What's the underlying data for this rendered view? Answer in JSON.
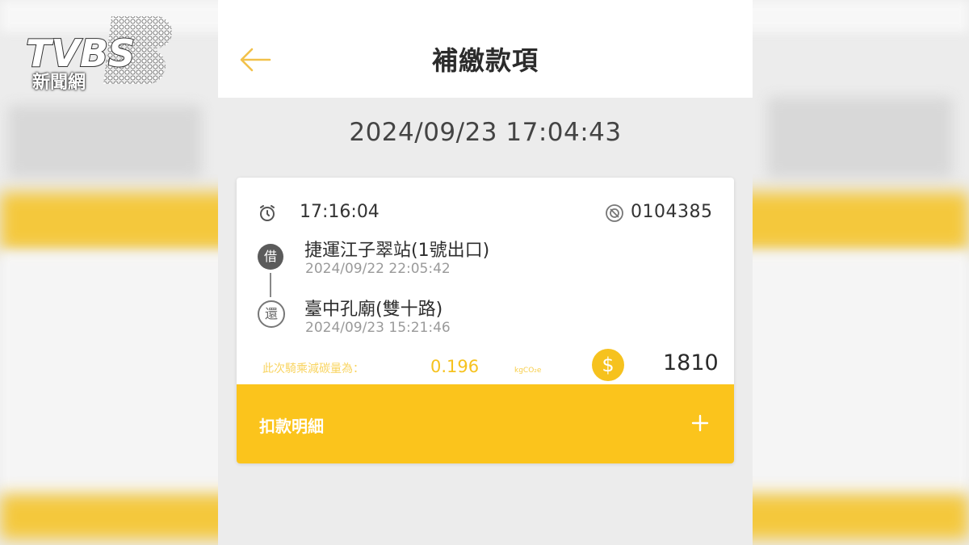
{
  "logo": {
    "brand": "TVBS",
    "subtitle": "新聞網"
  },
  "header": {
    "title": "補繳款項",
    "back_icon": "arrow-left-icon"
  },
  "timestamp": "2024/09/23 17:04:43",
  "trip": {
    "duration": "17:16:04",
    "bike_number": "0104385",
    "borrow": {
      "badge": "借",
      "station": "捷運江子翠站(1號出口)",
      "time": "2024/09/22 22:05:42"
    },
    "return": {
      "badge": "還",
      "station": "臺中孔廟(雙十路)",
      "time": "2024/09/23 15:21:46"
    },
    "carbon_label": "此次騎乘減碳量為：",
    "carbon_value": "0.196",
    "carbon_unit": "kgCO₂e",
    "amount": "1810",
    "coin_symbol": "$"
  },
  "detail": {
    "label": "扣款明細",
    "expand_icon": "plus-icon"
  },
  "colors": {
    "accent": "#fbc41c",
    "text": "#2e2e2e",
    "muted": "#9a9a9a",
    "background": "#ececec"
  }
}
